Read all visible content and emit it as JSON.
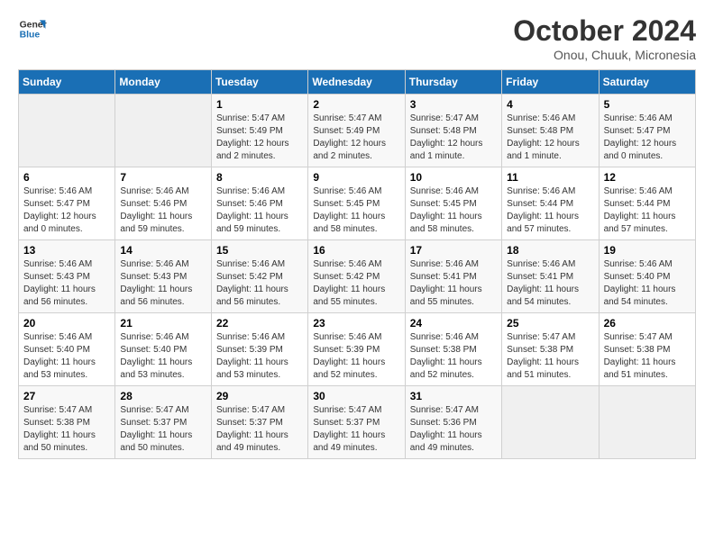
{
  "header": {
    "logo_line1": "General",
    "logo_line2": "Blue",
    "month_title": "October 2024",
    "subtitle": "Onou, Chuuk, Micronesia"
  },
  "weekdays": [
    "Sunday",
    "Monday",
    "Tuesday",
    "Wednesday",
    "Thursday",
    "Friday",
    "Saturday"
  ],
  "weeks": [
    [
      {
        "day": "",
        "info": ""
      },
      {
        "day": "",
        "info": ""
      },
      {
        "day": "1",
        "info": "Sunrise: 5:47 AM\nSunset: 5:49 PM\nDaylight: 12 hours\nand 2 minutes."
      },
      {
        "day": "2",
        "info": "Sunrise: 5:47 AM\nSunset: 5:49 PM\nDaylight: 12 hours\nand 2 minutes."
      },
      {
        "day": "3",
        "info": "Sunrise: 5:47 AM\nSunset: 5:48 PM\nDaylight: 12 hours\nand 1 minute."
      },
      {
        "day": "4",
        "info": "Sunrise: 5:46 AM\nSunset: 5:48 PM\nDaylight: 12 hours\nand 1 minute."
      },
      {
        "day": "5",
        "info": "Sunrise: 5:46 AM\nSunset: 5:47 PM\nDaylight: 12 hours\nand 0 minutes."
      }
    ],
    [
      {
        "day": "6",
        "info": "Sunrise: 5:46 AM\nSunset: 5:47 PM\nDaylight: 12 hours\nand 0 minutes."
      },
      {
        "day": "7",
        "info": "Sunrise: 5:46 AM\nSunset: 5:46 PM\nDaylight: 11 hours\nand 59 minutes."
      },
      {
        "day": "8",
        "info": "Sunrise: 5:46 AM\nSunset: 5:46 PM\nDaylight: 11 hours\nand 59 minutes."
      },
      {
        "day": "9",
        "info": "Sunrise: 5:46 AM\nSunset: 5:45 PM\nDaylight: 11 hours\nand 58 minutes."
      },
      {
        "day": "10",
        "info": "Sunrise: 5:46 AM\nSunset: 5:45 PM\nDaylight: 11 hours\nand 58 minutes."
      },
      {
        "day": "11",
        "info": "Sunrise: 5:46 AM\nSunset: 5:44 PM\nDaylight: 11 hours\nand 57 minutes."
      },
      {
        "day": "12",
        "info": "Sunrise: 5:46 AM\nSunset: 5:44 PM\nDaylight: 11 hours\nand 57 minutes."
      }
    ],
    [
      {
        "day": "13",
        "info": "Sunrise: 5:46 AM\nSunset: 5:43 PM\nDaylight: 11 hours\nand 56 minutes."
      },
      {
        "day": "14",
        "info": "Sunrise: 5:46 AM\nSunset: 5:43 PM\nDaylight: 11 hours\nand 56 minutes."
      },
      {
        "day": "15",
        "info": "Sunrise: 5:46 AM\nSunset: 5:42 PM\nDaylight: 11 hours\nand 56 minutes."
      },
      {
        "day": "16",
        "info": "Sunrise: 5:46 AM\nSunset: 5:42 PM\nDaylight: 11 hours\nand 55 minutes."
      },
      {
        "day": "17",
        "info": "Sunrise: 5:46 AM\nSunset: 5:41 PM\nDaylight: 11 hours\nand 55 minutes."
      },
      {
        "day": "18",
        "info": "Sunrise: 5:46 AM\nSunset: 5:41 PM\nDaylight: 11 hours\nand 54 minutes."
      },
      {
        "day": "19",
        "info": "Sunrise: 5:46 AM\nSunset: 5:40 PM\nDaylight: 11 hours\nand 54 minutes."
      }
    ],
    [
      {
        "day": "20",
        "info": "Sunrise: 5:46 AM\nSunset: 5:40 PM\nDaylight: 11 hours\nand 53 minutes."
      },
      {
        "day": "21",
        "info": "Sunrise: 5:46 AM\nSunset: 5:40 PM\nDaylight: 11 hours\nand 53 minutes."
      },
      {
        "day": "22",
        "info": "Sunrise: 5:46 AM\nSunset: 5:39 PM\nDaylight: 11 hours\nand 53 minutes."
      },
      {
        "day": "23",
        "info": "Sunrise: 5:46 AM\nSunset: 5:39 PM\nDaylight: 11 hours\nand 52 minutes."
      },
      {
        "day": "24",
        "info": "Sunrise: 5:46 AM\nSunset: 5:38 PM\nDaylight: 11 hours\nand 52 minutes."
      },
      {
        "day": "25",
        "info": "Sunrise: 5:47 AM\nSunset: 5:38 PM\nDaylight: 11 hours\nand 51 minutes."
      },
      {
        "day": "26",
        "info": "Sunrise: 5:47 AM\nSunset: 5:38 PM\nDaylight: 11 hours\nand 51 minutes."
      }
    ],
    [
      {
        "day": "27",
        "info": "Sunrise: 5:47 AM\nSunset: 5:38 PM\nDaylight: 11 hours\nand 50 minutes."
      },
      {
        "day": "28",
        "info": "Sunrise: 5:47 AM\nSunset: 5:37 PM\nDaylight: 11 hours\nand 50 minutes."
      },
      {
        "day": "29",
        "info": "Sunrise: 5:47 AM\nSunset: 5:37 PM\nDaylight: 11 hours\nand 49 minutes."
      },
      {
        "day": "30",
        "info": "Sunrise: 5:47 AM\nSunset: 5:37 PM\nDaylight: 11 hours\nand 49 minutes."
      },
      {
        "day": "31",
        "info": "Sunrise: 5:47 AM\nSunset: 5:36 PM\nDaylight: 11 hours\nand 49 minutes."
      },
      {
        "day": "",
        "info": ""
      },
      {
        "day": "",
        "info": ""
      }
    ]
  ]
}
